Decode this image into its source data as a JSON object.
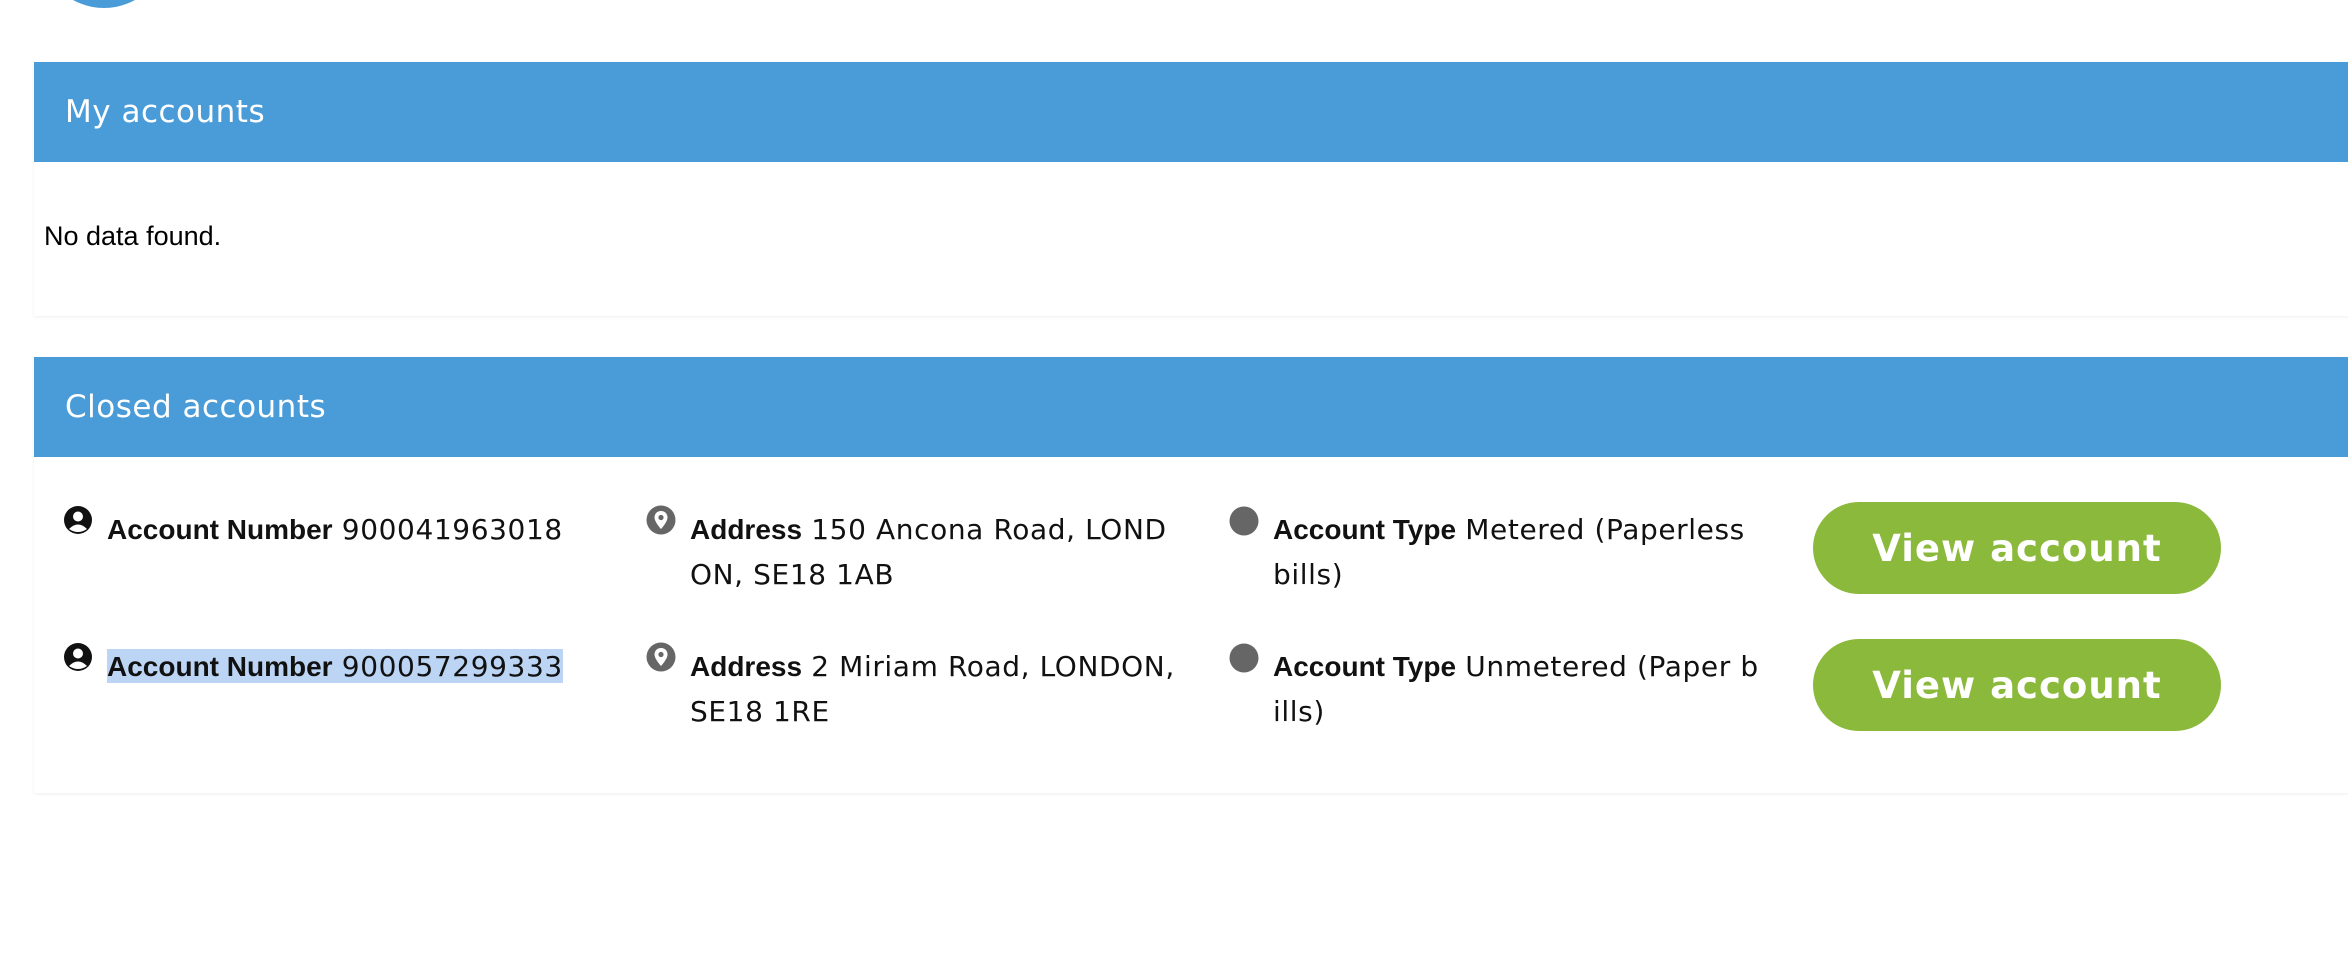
{
  "colors": {
    "header_blue": "#4a9cd9",
    "button_green": "#8bb93b",
    "selection": "#bcd5f5",
    "icon_gray": "#666666"
  },
  "my_accounts": {
    "title": "My accounts",
    "empty_message": "No data found."
  },
  "closed_accounts": {
    "title": "Closed accounts",
    "rows": [
      {
        "account_label": "Account Number",
        "account_number": "900041963018",
        "address_label": "Address",
        "address_line1": "150 Ancona Road, LOND",
        "address_line2": "ON, SE18 1AB",
        "type_label": "Account Type",
        "type_line1": "Metered (Paperless",
        "type_line2": "bills)",
        "button_label": "View account",
        "icons": {
          "account": "user-circle-icon",
          "address": "map-pin-icon",
          "type": "dot-icon"
        }
      },
      {
        "account_label": "Account Number",
        "account_number": "900057299333",
        "address_label": "Address",
        "address_line1": "2 Miriam Road, LONDON,",
        "address_line2": "SE18 1RE",
        "type_label": "Account Type",
        "type_line1": "Unmetered (Paper b",
        "type_line2": "ills)",
        "button_label": "View account",
        "icons": {
          "account": "user-circle-icon",
          "address": "map-pin-icon",
          "type": "dot-icon"
        }
      }
    ]
  }
}
